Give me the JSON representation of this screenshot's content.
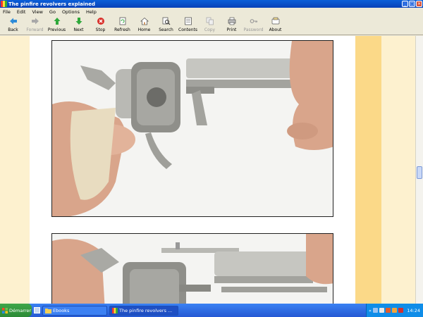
{
  "window": {
    "title": "The pinfire revolvers explained"
  },
  "menu": [
    "File",
    "Edit",
    "View",
    "Go",
    "Options",
    "Help"
  ],
  "toolbar": [
    {
      "label": "Back",
      "icon": "back-arrow-icon",
      "enabled": true
    },
    {
      "label": "Forward",
      "icon": "forward-arrow-icon",
      "enabled": false
    },
    {
      "label": "Previous",
      "icon": "up-arrow-icon",
      "enabled": true
    },
    {
      "label": "Next",
      "icon": "down-arrow-icon",
      "enabled": true
    },
    {
      "label": "Stop",
      "icon": "stop-icon",
      "enabled": true
    },
    {
      "label": "Refresh",
      "icon": "refresh-icon",
      "enabled": true
    },
    {
      "label": "Home",
      "icon": "home-icon",
      "enabled": true
    },
    {
      "label": "Search",
      "icon": "search-icon",
      "enabled": true
    },
    {
      "label": "Contents",
      "icon": "contents-icon",
      "enabled": true
    },
    {
      "label": "Copy",
      "icon": "copy-icon",
      "enabled": false
    },
    {
      "label": "Print",
      "icon": "print-icon",
      "enabled": true
    },
    {
      "label": "Password",
      "icon": "key-icon",
      "enabled": false
    },
    {
      "label": "About",
      "icon": "help-icon",
      "enabled": true
    }
  ],
  "taskbar": {
    "start_label": "Démarrer",
    "tasks": [
      {
        "label": "Ebooks",
        "icon": "folder-icon"
      },
      {
        "label": "The pinfire revolvers ...",
        "icon": "ebook-icon"
      }
    ],
    "tray_chevron": "«",
    "clock": "14:24"
  },
  "colors": {
    "page_bg": "#fdf1cf",
    "accent_strip": "#fbd988",
    "titlebar": "#0a5fd8",
    "taskbar": "#2f6ae6"
  }
}
